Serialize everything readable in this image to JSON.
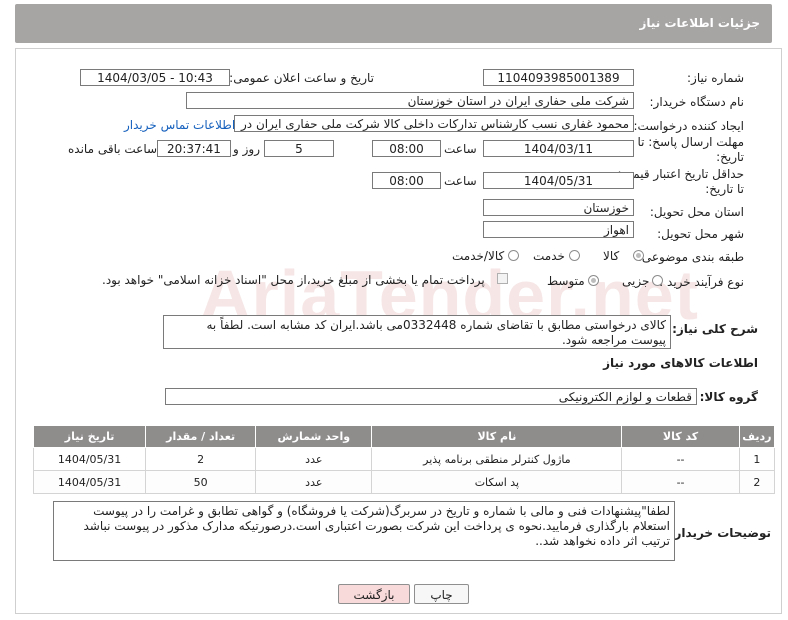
{
  "header": {
    "title": "جزئیات اطلاعات نیاز"
  },
  "watermark": "AriaTender.net",
  "fields": {
    "need_number_label": "شماره نیاز:",
    "need_number": "1104093985001389",
    "announce_label": "تاریخ و ساعت اعلان عمومی:",
    "announce_value": "1404/03/05 - 10:43",
    "buyer_label": "نام دستگاه خریدار:",
    "buyer_value": "شرکت ملی حفاری ایران در استان خوزستان",
    "creator_label": "ایجاد کننده درخواست:",
    "creator_value": "محمود غفاری نسب کارشناس تدارکات داخلی  کالا شرکت ملی حفاری ایران در",
    "contact_link": "اطلاعات تماس خریدار",
    "deadline_label_1": "مهلت ارسال پاسخ: تا",
    "deadline_label_2": "تاریخ:",
    "deadline_date": "1404/03/11",
    "time_label": "ساعت",
    "deadline_time": "08:00",
    "days_value": "5",
    "days_label": "روز و",
    "remaining_time": "20:37:41",
    "remaining_label": "ساعت باقی مانده",
    "validity_label_1": "حداقل تاریخ اعتبار قیمت:",
    "validity_label_2": "تا تاریخ:",
    "validity_date": "1404/05/31",
    "validity_time": "08:00",
    "province_label": "استان محل تحویل:",
    "province_value": "خوزستان",
    "city_label": "شهر محل تحویل:",
    "city_value": "اهواز",
    "category_label": "طبقه بندی موضوعی:",
    "category_options": [
      "کالا",
      "خدمت",
      "کالا/خدمت"
    ],
    "process_label": "نوع فرآیند خرید :",
    "process_options": [
      "جزیی",
      "متوسط"
    ],
    "process_note": "پرداخت تمام یا بخشی از مبلغ خرید،از محل \"اسناد خزانه اسلامی\" خواهد بود.",
    "description_label": "شرح کلی نیاز:",
    "description_value": "کالای درخواستی مطابق با تقاضای شماره 0332448می باشد.ایران کد مشابه است. لطفاً به پیوست مراجعه شود.",
    "goods_info_title": "اطلاعات کالاهای مورد نیاز",
    "goods_group_label": "گروه کالا:",
    "goods_group_value": "قطعات و لوازم الکترونیکی"
  },
  "table": {
    "columns": [
      "ردیف",
      "کد کالا",
      "نام کالا",
      "واحد شمارش",
      "تعداد / مقدار",
      "تاریخ نیاز"
    ],
    "rows": [
      [
        "1",
        "--",
        "ماژول کنترلر منطقی برنامه پذیر",
        "عدد",
        "2",
        "1404/05/31"
      ],
      [
        "2",
        "--",
        "پد اسکات",
        "عدد",
        "50",
        "1404/05/31"
      ]
    ]
  },
  "buyer_notes_label": "توضیحات خریدار:",
  "buyer_notes_value": "لطفا\"پیشنهادات فنی و مالی با شماره و تاریخ در سربرگ(شرکت یا فروشگاه) و گواهی تطابق و غرامت را در پیوست استعلام بارگذاری فرمایید.نحوه ی پرداخت این شرکت بصورت اعتباری است.درصورتیکه مدارک مذکور در پیوست نباشد ترتیب اثر داده نخواهد شد..",
  "buttons": {
    "print": "چاپ",
    "back": "بازگشت"
  },
  "colors": {
    "header_bg": "#a7a4a4",
    "table_header_bg": "#8f8c8c",
    "link": "#1560bd",
    "back_button_bg": "#f9dada"
  }
}
